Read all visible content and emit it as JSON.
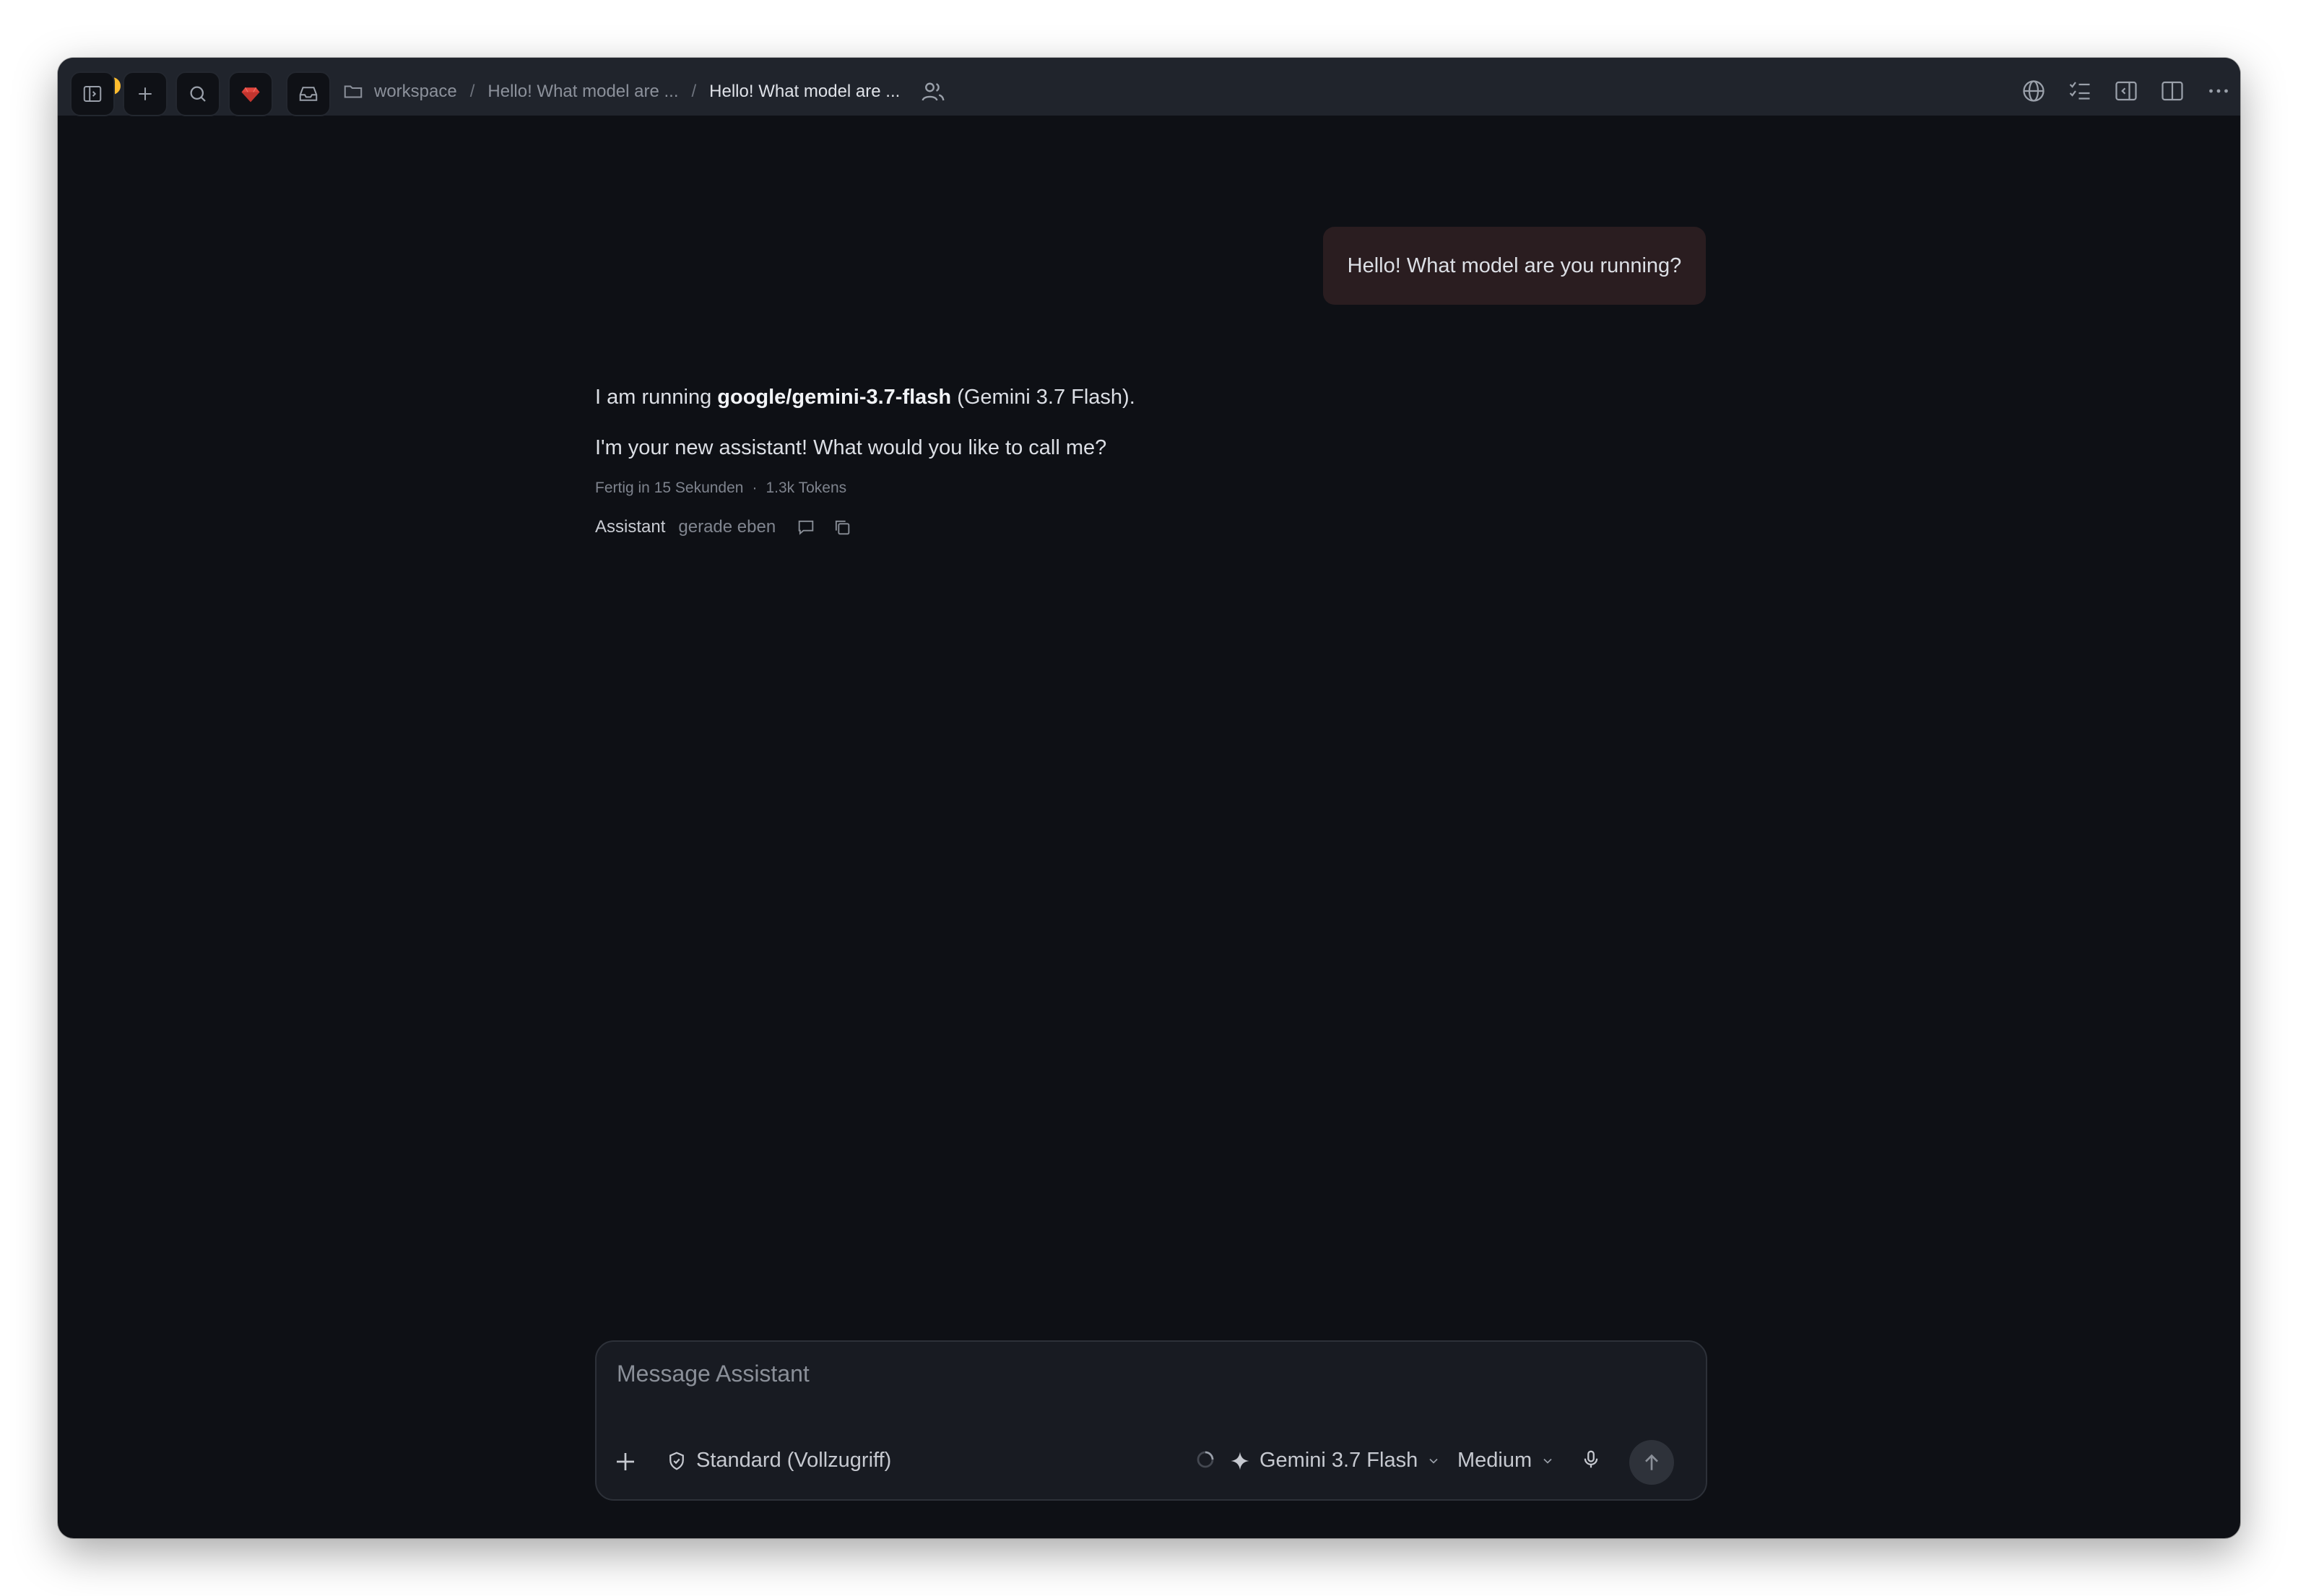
{
  "breadcrumb": {
    "root": "workspace",
    "parent": "Hello! What model are ...",
    "current": "Hello! What model are ..."
  },
  "conversation": {
    "user_message": "Hello! What model are you running?",
    "assistant": {
      "line1_prefix": "I am running ",
      "line1_bold": "google/gemini-3.7-flash",
      "line1_suffix": " (Gemini 3.7 Flash).",
      "line2": "I'm your new assistant! What would you like to call me?",
      "meta_duration": "Fertig in 15 Sekunden",
      "meta_separator": "·",
      "meta_tokens": "1.3k Tokens",
      "author": "Assistant",
      "time": "gerade eben"
    }
  },
  "composer": {
    "placeholder": "Message Assistant",
    "permission_label": "Standard (Vollzugriff)",
    "model_label": "Gemini 3.7 Flash",
    "effort_label": "Medium"
  },
  "icons": {
    "sidebar": "sidebar-toggle-icon",
    "new": "plus-icon",
    "search": "search-icon",
    "brand": "gem-logo-icon",
    "inbox": "inbox-icon",
    "folder": "folder-icon",
    "people": "people-icon",
    "globe": "globe-icon",
    "checklist": "checklist-icon",
    "panel_left": "panel-left-icon",
    "split": "split-view-icon",
    "more": "more-icon"
  },
  "colors": {
    "background": "#0e1015",
    "titlebar": "#20242c",
    "user_bubble": "#2a1d20",
    "brand": "#e0443c",
    "composer": "#181b22"
  }
}
